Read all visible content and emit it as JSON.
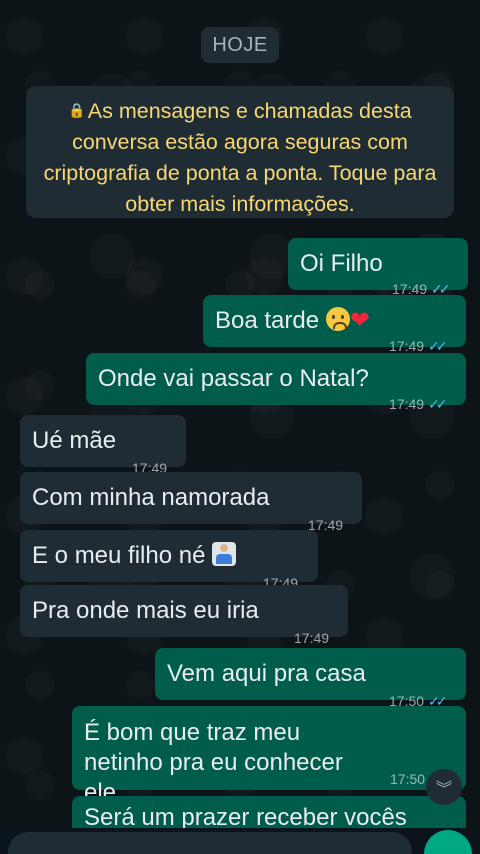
{
  "date_chip": "HOJE",
  "encryption_notice": "As mensagens e chamadas desta conversa estão agora seguras com criptografia de ponta a ponta. Toque para obter mais informações.",
  "messages": [
    {
      "text": "Oi Filho",
      "time": "17:49",
      "dir": "out"
    },
    {
      "text": "Boa tarde",
      "time": "17:49",
      "dir": "out",
      "emoji": [
        "sad-face",
        "red-heart"
      ]
    },
    {
      "text": "Onde vai passar o Natal?",
      "time": "17:49",
      "dir": "out"
    },
    {
      "text": "Ué mãe",
      "time": "17:49",
      "dir": "in"
    },
    {
      "text": "Com minha namorada",
      "time": "17:49",
      "dir": "in"
    },
    {
      "text": "E o meu filho né",
      "time": "17:49",
      "dir": "in",
      "emoji": [
        "person-shrugging"
      ]
    },
    {
      "text": "Pra onde mais eu iria",
      "time": "17:49",
      "dir": "in"
    },
    {
      "text": "Vem aqui pra casa",
      "time": "17:50",
      "dir": "out"
    },
    {
      "text": "É bom que traz meu netinho pra eu conhecer ele",
      "time": "17:50",
      "dir": "out"
    },
    {
      "text": "Será um prazer receber vocês",
      "time": "",
      "dir": "out"
    }
  ],
  "ticks": "✓✓",
  "icons": {
    "lock": "lock-icon",
    "scroll_down": "chevron-double-down-icon",
    "mic": "mic-icon"
  },
  "colors": {
    "background": "#0b141a",
    "outgoing_bubble": "#005c4b",
    "incoming_bubble": "#1f2c33",
    "notice_text": "#f7d774",
    "read_ticks": "#53bdeb"
  }
}
